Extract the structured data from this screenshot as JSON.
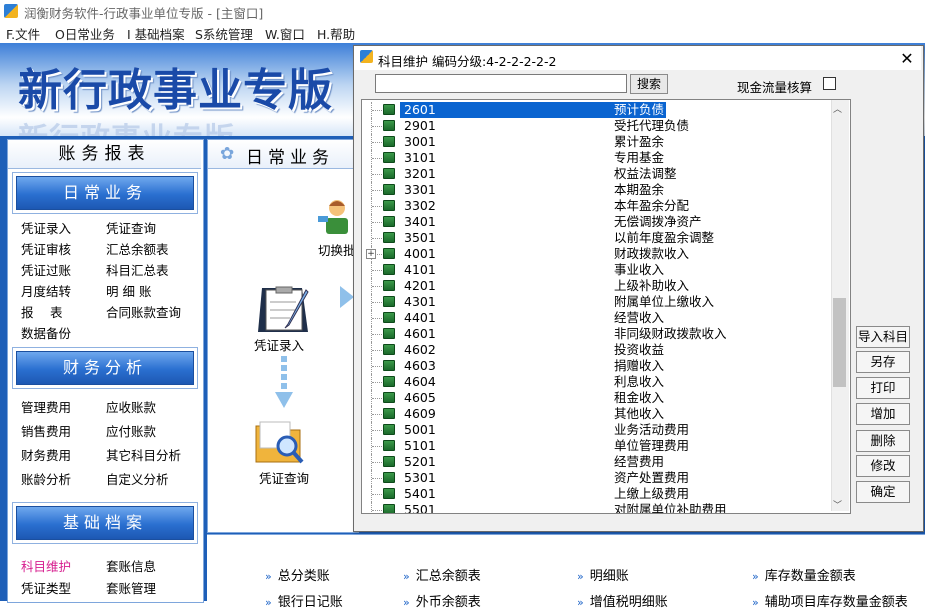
{
  "window": {
    "title": "润衡财务软件-行政事业单位专版 - [主窗口]"
  },
  "menu": [
    "F.文件",
    "O日常业务",
    "I 基础档案",
    "S系统管理",
    "W.窗口",
    "H.帮助"
  ],
  "banner": {
    "title": "新行政事业专版"
  },
  "sidebar": {
    "title": "账务报表",
    "sections": [
      {
        "title": "日常业务",
        "items": [
          "凭证录入",
          "凭证查询",
          "凭证审核",
          "汇总余额表",
          "凭证过账",
          "科目汇总表",
          "月度结转",
          "明 细 账",
          "报　 表",
          "合同账款查询",
          "数据备份"
        ]
      },
      {
        "title": "财务分析",
        "items": [
          "管理费用",
          "应收账款",
          "销售费用",
          "应付账款",
          "财务费用",
          "其它科目分析",
          "账龄分析",
          "自定义分析"
        ]
      },
      {
        "title": "基础档案",
        "items": [
          "科目维护",
          "套账信息",
          "凭证类型",
          "套账管理"
        ]
      }
    ]
  },
  "center": {
    "tab_label": "日常业务",
    "flow": {
      "switch_label": "切换批",
      "entry_label": "凭证录入",
      "query_label": "凭证查询"
    }
  },
  "quick_links": [
    [
      "总分类账",
      "汇总余额表",
      "明细账",
      "库存数量金额表"
    ],
    [
      "银行日记账",
      "外币余额表",
      "增值税明细账",
      "辅助项目库存数量金额表"
    ]
  ],
  "dialog": {
    "title": "科目维护   编码分级:4-2-2-2-2-2",
    "search_placeholder": "",
    "search_button": "搜索",
    "cashflow_label": "现金流量核算",
    "cashflow_checked": false,
    "accounts": [
      {
        "code": "2601",
        "name": "预计负债",
        "selected": true
      },
      {
        "code": "2901",
        "name": "受托代理负债"
      },
      {
        "code": "3001",
        "name": "累计盈余"
      },
      {
        "code": "3101",
        "name": "专用基金"
      },
      {
        "code": "3201",
        "name": "权益法调整"
      },
      {
        "code": "3301",
        "name": "本期盈余"
      },
      {
        "code": "3302",
        "name": "本年盈余分配"
      },
      {
        "code": "3401",
        "name": "无偿调拨净资产"
      },
      {
        "code": "3501",
        "name": "以前年度盈余调整"
      },
      {
        "code": "4001",
        "name": "财政拨款收入",
        "expandable": true
      },
      {
        "code": "4101",
        "name": "事业收入"
      },
      {
        "code": "4201",
        "name": "上级补助收入"
      },
      {
        "code": "4301",
        "name": "附属单位上缴收入"
      },
      {
        "code": "4401",
        "name": "经营收入"
      },
      {
        "code": "4601",
        "name": "非同级财政拨款收入"
      },
      {
        "code": "4602",
        "name": "投资收益"
      },
      {
        "code": "4603",
        "name": "捐赠收入"
      },
      {
        "code": "4604",
        "name": "利息收入"
      },
      {
        "code": "4605",
        "name": "租金收入"
      },
      {
        "code": "4609",
        "name": "其他收入"
      },
      {
        "code": "5001",
        "name": "业务活动费用"
      },
      {
        "code": "5101",
        "name": "单位管理费用"
      },
      {
        "code": "5201",
        "name": "经营费用"
      },
      {
        "code": "5301",
        "name": "资产处置费用"
      },
      {
        "code": "5401",
        "name": "上缴上级费用"
      },
      {
        "code": "5501",
        "name": "对附属单位补助费用"
      }
    ],
    "buttons": [
      "导入科目",
      "另存",
      "打印",
      "增加",
      "删除",
      "修改",
      "确定"
    ]
  }
}
